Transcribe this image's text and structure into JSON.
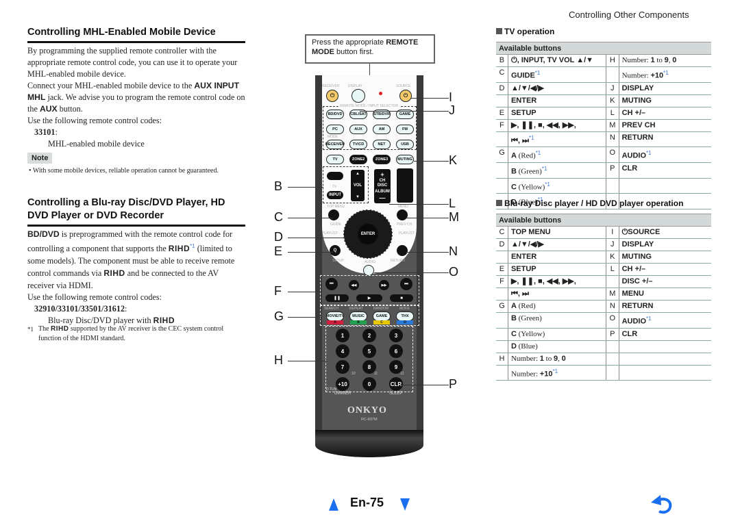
{
  "page": {
    "header_right": "Controlling Other Components",
    "page_number": "En-75",
    "icons": {
      "prev": "prev-page-triangle-icon",
      "next": "next-page-triangle-icon",
      "back": "back-return-arrow-icon"
    }
  },
  "mhl": {
    "title": "Controlling MHL-Enabled Mobile Device",
    "p1": "By programming the supplied remote controller with the appropriate remote control code, you can use it to operate your MHL-enabled mobile device.",
    "p2_a": "Connect your MHL-enabled mobile device to the ",
    "p2_b": "AUX INPUT MHL",
    "p2_c": " jack. We advise you to program the remote control code on the ",
    "p2_d": "AUX",
    "p2_e": " button.",
    "p3": "Use the following remote control codes:",
    "code": "33101",
    "code_desc": "MHL-enabled mobile device",
    "note_label": "Note",
    "note_text": "With some mobile devices, reliable operation cannot be guaranteed."
  },
  "bd": {
    "title": "Controlling a Blu-ray Disc/DVD Player, HD DVD Player or DVD Recorder",
    "p1_a": "BD/DVD",
    "p1_b": " is preprogrammed with the remote control code for controlling a component that supports the ",
    "rihd": "RIHD",
    "fn_mark": "*1",
    "p1_c": " (limited to some models). The component must be able to receive remote control commands via ",
    "p1_d": " and be connected to the AV receiver via HDMI.",
    "p2": "Use the following remote control codes:",
    "codes": "32910/33101/33501/31612",
    "codes_desc": "Blu-ray Disc/DVD player with ",
    "footnote_mark": "*1",
    "footnote_a": "The ",
    "footnote_b": " supported by the AV receiver is the CEC system control function of the HDMI standard."
  },
  "remote": {
    "callout_a": "Press the appropriate ",
    "callout_b": "REMOTE MODE",
    "callout_c": " button first.",
    "labels": {
      "receiver": "RECEIVER",
      "display": "DISPLAY",
      "source": "SOURCE",
      "remote_mode": "REMOTE MODE / INPUT SELECTOR",
      "mode": "MODE",
      "tv": "TV",
      "vol": "VOL",
      "ch_disc": "CH DISC",
      "album": "ALBUM",
      "top_menu": "TOP MENU",
      "menu": "MENU",
      "guide": "GUIDE",
      "prev_ch": "PREV CH",
      "playlist_l": "PLAYLIST",
      "playlist_r": "PLAYLIST",
      "setup": "SETUP",
      "return": "RETURN",
      "audio": "AUDIO",
      "search": "SEARCH",
      "repeat": "REPEAT",
      "random": "RANDOM",
      "mode2": "MODE",
      "dimmer": "DIMMER",
      "sleep": "SLEEP",
      "dtun": "D.TUN",
      "ten": "10",
      "eleven": "11",
      "twelve": "12",
      "brand": "ONKYO",
      "model": "RC-837M"
    },
    "row1": [
      "BD/DVD",
      "CBL/SAT",
      "STB/DVR",
      "GAME"
    ],
    "row2": [
      "PC",
      "AUX",
      "AM",
      "FM"
    ],
    "row3": [
      "RECEIVER",
      "TV/CD",
      "NET",
      "USB"
    ],
    "row4": [
      "TV",
      "ZONE2",
      "ZONE3",
      "MUTING"
    ],
    "input": "INPUT",
    "enter": "ENTER",
    "q": "Q",
    "transport_top": [
      "⏮",
      "◀◀",
      "▶▶",
      "⏭"
    ],
    "transport_bottom": [
      "❚❚",
      "▶",
      "■"
    ],
    "mode_buttons": [
      "MOVIE/TV",
      "MUSIC",
      "GAME",
      "THX"
    ],
    "color_keys": [
      {
        "label": "A",
        "color": "#d0203c"
      },
      {
        "label": "B",
        "color": "#22a050"
      },
      {
        "label": "C",
        "color": "#e8c800"
      },
      {
        "label": "D",
        "color": "#2a78d8"
      }
    ],
    "numbers": [
      "1",
      "2",
      "3",
      "4",
      "5",
      "6",
      "7",
      "8",
      "9",
      "+10",
      "0",
      "CLR"
    ],
    "callout_letters": [
      "B",
      "C",
      "D",
      "E",
      "F",
      "G",
      "H",
      "I",
      "J",
      "K",
      "L",
      "M",
      "N",
      "O",
      "P"
    ]
  },
  "tv_table": {
    "title": "TV operation",
    "header": "Available buttons",
    "rows": [
      {
        "k1": "B",
        "v1": "⏻, INPUT, TV VOL ▲/▼",
        "k2": "H",
        "v2a": "Number: ",
        "v2b": "1",
        "v2c": " to ",
        "v2d": "9",
        "v2e": ", ",
        "v2f": "0"
      },
      {
        "k1": "C",
        "v1": "GUIDE",
        "k2": "",
        "v2a": "Number: ",
        "v2b": "+10",
        "fn": "*1"
      },
      {
        "k1": "D",
        "v1": "▲/▼/◀/▶",
        "k2": "J",
        "v2": "DISPLAY"
      },
      {
        "k1": "",
        "v1": "ENTER",
        "k2": "K",
        "v2": "MUTING"
      },
      {
        "k1": "E",
        "v1": "SETUP",
        "k2": "L",
        "v2": "CH +/–"
      },
      {
        "k1": "F",
        "v1": "▶, ❚❚, ■, ◀◀, ▶▶,",
        "k2": "M",
        "v2": "PREV CH"
      },
      {
        "k1": "",
        "v1": "⏮, ⏭",
        "fn": "*1",
        "k2": "N",
        "v2": "RETURN"
      },
      {
        "k1": "G",
        "v1b": "A",
        "v1": " (Red)",
        "fn": "*1",
        "k2": "O",
        "v2": "AUDIO",
        "fn2": "*1"
      },
      {
        "k1": "",
        "v1b": "B",
        "v1": " (Green)",
        "fn": "*1",
        "k2": "P",
        "v2": "CLR"
      },
      {
        "k1": "",
        "v1b": "C",
        "v1": " (Yellow)",
        "fn": "*1",
        "k2": "",
        "v2": ""
      },
      {
        "k1": "",
        "v1b": "D",
        "v1": " (Blue)",
        "fn": "*1",
        "k2": "",
        "v2": ""
      }
    ]
  },
  "bd_table": {
    "title": "Blu-ray Disc player / HD DVD player operation",
    "header": "Available buttons",
    "rows": [
      {
        "k1": "C",
        "v1": "TOP MENU",
        "k2": "I",
        "v2": "⏻SOURCE"
      },
      {
        "k1": "D",
        "v1": "▲/▼/◀/▶",
        "k2": "J",
        "v2": "DISPLAY"
      },
      {
        "k1": "",
        "v1": "ENTER",
        "k2": "K",
        "v2": "MUTING"
      },
      {
        "k1": "E",
        "v1": "SETUP",
        "k2": "L",
        "v2": "CH +/–"
      },
      {
        "k1": "F",
        "v1": "▶, ❚❚, ■, ◀◀, ▶▶,",
        "k2": "",
        "v2": "DISC +/–"
      },
      {
        "k1": "",
        "v1": "⏮, ⏭",
        "k2": "M",
        "v2": "MENU"
      },
      {
        "k1": "G",
        "v1b": "A",
        "v1": " (Red)",
        "k2": "N",
        "v2": "RETURN"
      },
      {
        "k1": "",
        "v1b": "B",
        "v1": " (Green)",
        "k2": "O",
        "v2": "AUDIO",
        "fn2": "*1"
      },
      {
        "k1": "",
        "v1b": "C",
        "v1": " (Yellow)",
        "k2": "P",
        "v2": "CLR"
      },
      {
        "k1": "",
        "v1b": "D",
        "v1": " (Blue)",
        "k2": "",
        "v2": ""
      },
      {
        "k1": "H",
        "v1a": "Number: ",
        "v1n1": "1",
        "v1t": " to ",
        "v1n2": "9",
        "v1c": ", ",
        "v1n3": "0",
        "k2": "",
        "v2": ""
      },
      {
        "k1": "",
        "v1a": "Number: ",
        "v1n1": "+10",
        "fn": "*1",
        "k2": "",
        "v2": ""
      }
    ]
  }
}
